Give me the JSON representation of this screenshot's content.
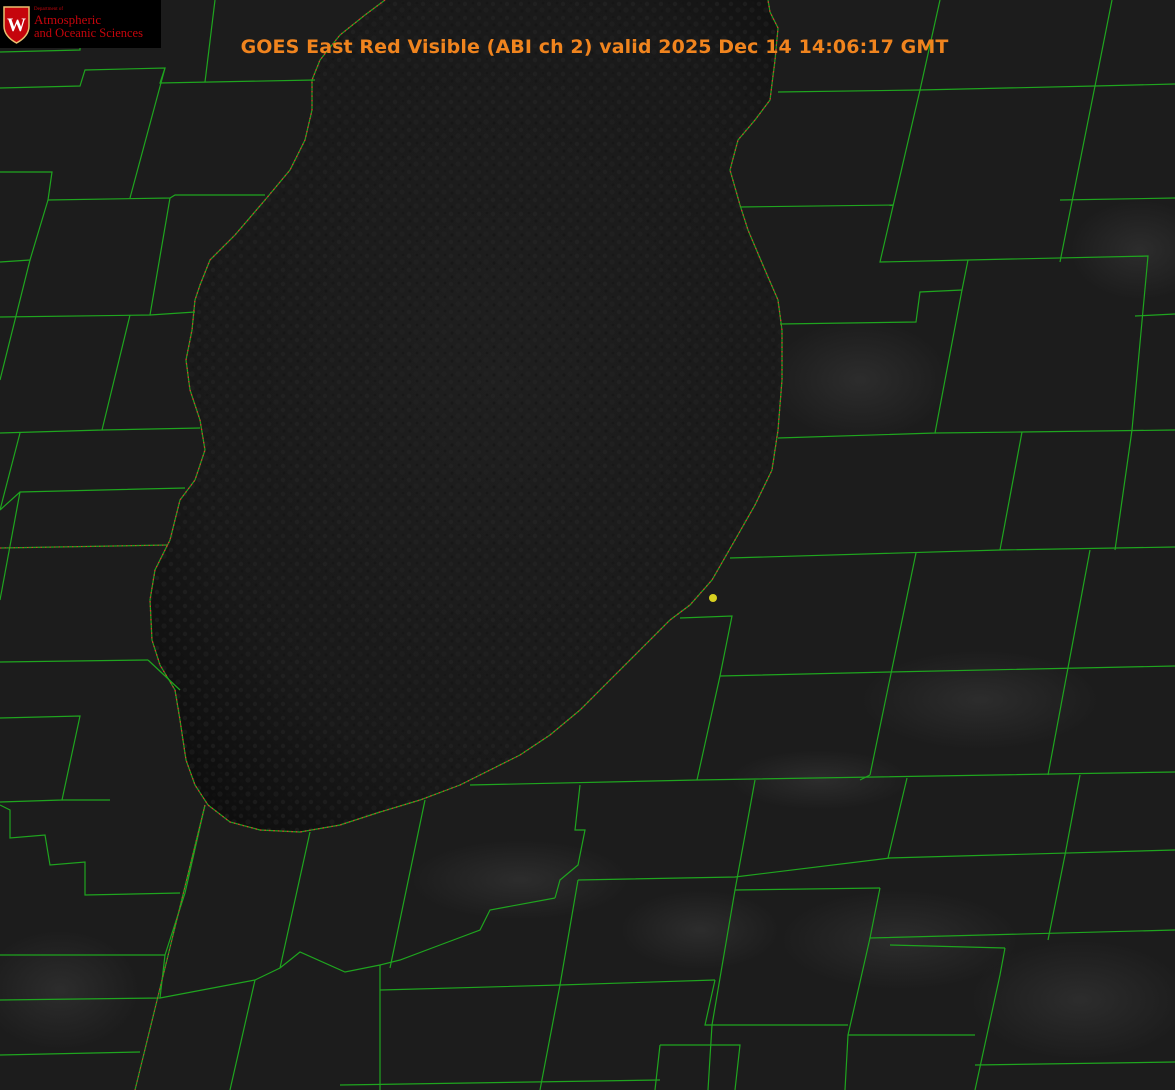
{
  "title": "GOES East Red Visible (ABI ch 2) valid 2025 Dec 14 14:06:17 GMT",
  "logo": {
    "department": "Department of",
    "line1": "Atmospheric",
    "line2": "and Oceanic Sciences",
    "crest_letter": "W"
  },
  "colors": {
    "title": "#f0841e",
    "county_lines": "#1fa51f",
    "shoreline": "#e03030",
    "marker": "#d8d020",
    "logo_text": "#c5050c",
    "lake": "#111111",
    "land": "#1b1b1b"
  },
  "icons": {
    "crest": "uw-crest-icon",
    "marker": "location-dot-icon"
  }
}
